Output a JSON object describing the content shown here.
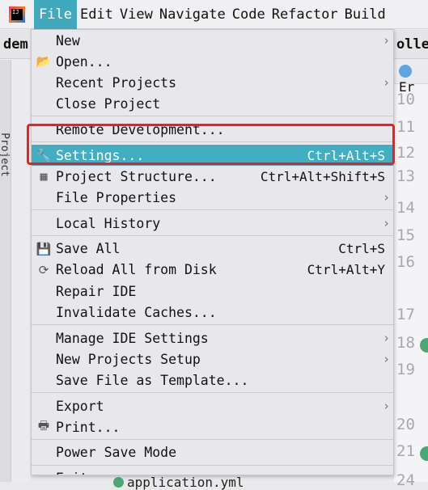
{
  "menubar": {
    "items": [
      "File",
      "Edit",
      "View",
      "Navigate",
      "Code",
      "Refactor",
      "Build"
    ],
    "active": "File"
  },
  "background": {
    "project_tab": "dem",
    "editor_tab": "olle",
    "breadcrumb": "Er",
    "tool_window": "Project",
    "line_numbers": [
      "10",
      "11",
      "12",
      "13",
      "14",
      "15",
      "16",
      "17",
      "18",
      "19",
      "20",
      "21",
      "24"
    ],
    "bottom_file": "application.yml"
  },
  "file_menu": {
    "groups": [
      [
        {
          "label": "New",
          "submenu": true
        },
        {
          "label": "Open...",
          "icon": "folder-open-icon"
        },
        {
          "label": "Recent Projects",
          "submenu": true
        },
        {
          "label": "Close Project"
        }
      ],
      [
        {
          "label": "Remote Development..."
        }
      ],
      [
        {
          "label": "Settings...",
          "icon": "wrench-icon",
          "shortcut": "Ctrl+Alt+S",
          "selected": true
        },
        {
          "label": "Project Structure...",
          "icon": "project-structure-icon",
          "shortcut": "Ctrl+Alt+Shift+S"
        },
        {
          "label": "File Properties",
          "submenu": true
        }
      ],
      [
        {
          "label": "Local History",
          "submenu": true
        }
      ],
      [
        {
          "label": "Save All",
          "icon": "save-icon",
          "shortcut": "Ctrl+S"
        },
        {
          "label": "Reload All from Disk",
          "icon": "reload-icon",
          "shortcut": "Ctrl+Alt+Y"
        },
        {
          "label": "Repair IDE"
        },
        {
          "label": "Invalidate Caches..."
        }
      ],
      [
        {
          "label": "Manage IDE Settings",
          "submenu": true
        },
        {
          "label": "New Projects Setup",
          "submenu": true
        },
        {
          "label": "Save File as Template..."
        }
      ],
      [
        {
          "label": "Export",
          "submenu": true
        },
        {
          "label": "Print...",
          "icon": "print-icon"
        }
      ],
      [
        {
          "label": "Power Save Mode"
        }
      ],
      [
        {
          "label": "Exit"
        }
      ]
    ]
  },
  "highlight_color": "#41aec2",
  "annotation_color": "#f31d1d"
}
